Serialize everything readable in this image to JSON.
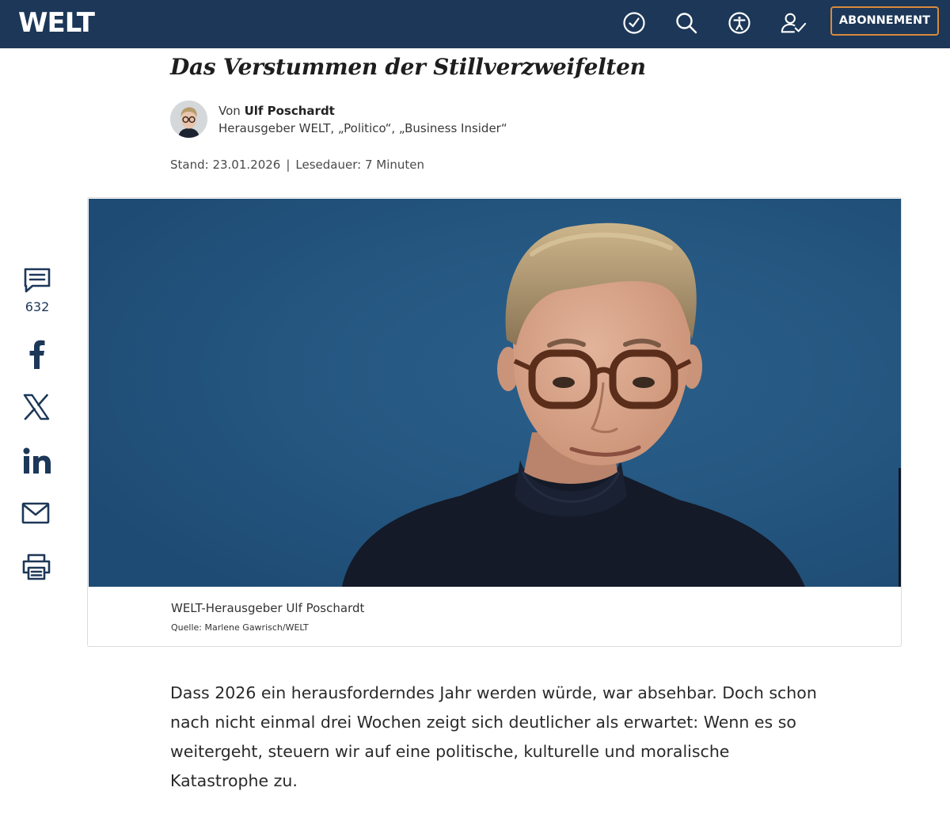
{
  "header": {
    "logo": "WELT",
    "icons": [
      "history-check-icon",
      "search-icon",
      "accessibility-icon",
      "login-user-icon"
    ],
    "subscribe_label": "ABONNEMENT",
    "colors": {
      "bar": "#1c3758",
      "accent": "#d98a3b"
    }
  },
  "article": {
    "title": "Das Verstummen der Stillverzweifelten",
    "author_prefix": "Von",
    "author_name": "Ulf Poschardt",
    "author_role": "Herausgeber WELT, „Politico“, „Business Insider“",
    "stand": "Stand: 23.01.2026",
    "separator": "|",
    "reading_time": "Lesedauer: 7 Minuten",
    "image_caption": "WELT-Herausgeber Ulf Poschardt",
    "image_source": "Quelle: Marlene Gawrisch/WELT",
    "lead": "Dass 2026 ein herausforderndes Jahr werden würde, war absehbar. Doch schon nach nicht einmal drei Wochen zeigt sich deutlicher als erwartet: Wenn es so weitergeht, steuern wir auf eine politische, kulturelle und moralische Katastrophe zu."
  },
  "share": {
    "comment_count": "632",
    "items": [
      "comment-icon",
      "facebook-icon",
      "x-icon",
      "linkedin-icon",
      "mail-icon",
      "print-icon"
    ]
  }
}
